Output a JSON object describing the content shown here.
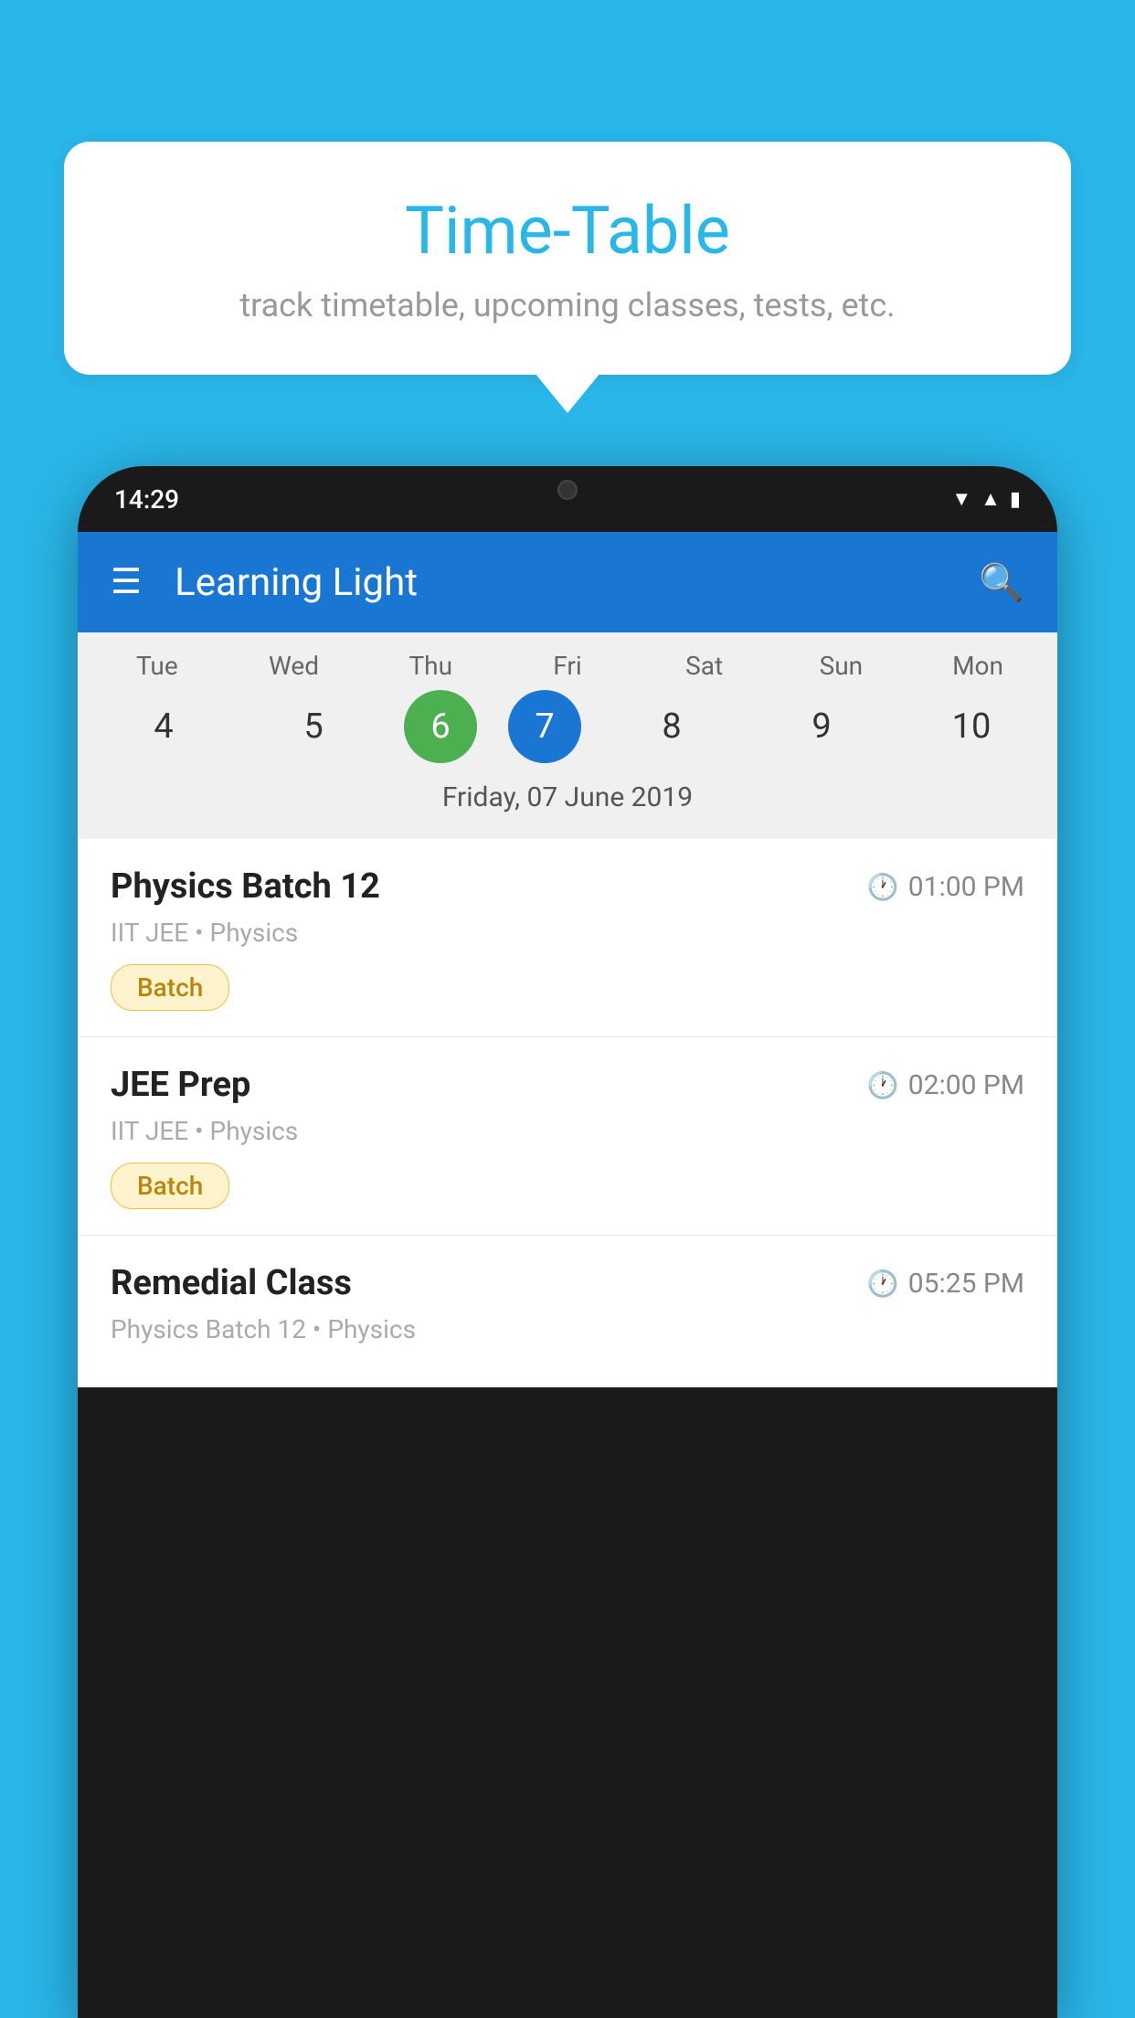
{
  "background_color": "#29B6E8",
  "speech_bubble": {
    "title": "Time-Table",
    "subtitle": "track timetable, upcoming classes, tests, etc."
  },
  "phone": {
    "time": "14:29",
    "app_bar": {
      "title": "Learning Light",
      "menu_icon": "≡",
      "search_icon": "🔍"
    },
    "calendar": {
      "days": [
        "Tue",
        "Wed",
        "Thu",
        "Fri",
        "Sat",
        "Sun",
        "Mon"
      ],
      "dates": [
        "4",
        "5",
        "6",
        "7",
        "8",
        "9",
        "10"
      ],
      "today_index": 2,
      "selected_index": 3,
      "selected_label": "Friday, 07 June 2019"
    },
    "classes": [
      {
        "name": "Physics Batch 12",
        "time": "01:00 PM",
        "info": "IIT JEE • Physics",
        "badge": "Batch"
      },
      {
        "name": "JEE Prep",
        "time": "02:00 PM",
        "info": "IIT JEE • Physics",
        "badge": "Batch"
      },
      {
        "name": "Remedial Class",
        "time": "05:25 PM",
        "info": "Physics Batch 12 • Physics",
        "badge": ""
      }
    ]
  }
}
